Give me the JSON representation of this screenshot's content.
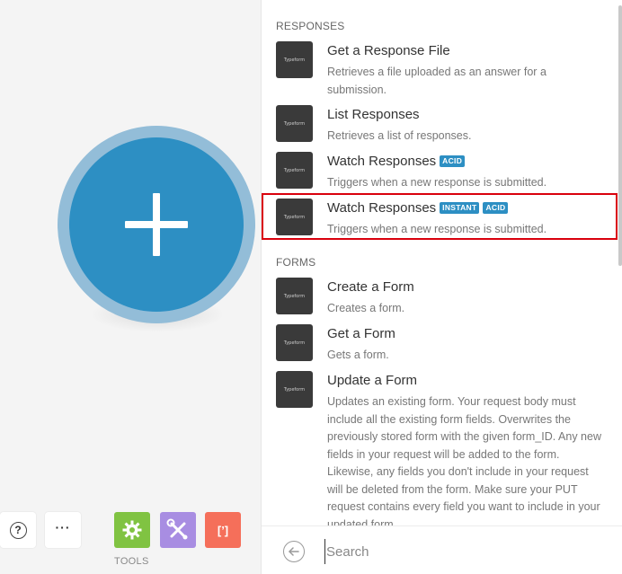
{
  "toolbar": {
    "help_icon_text": "?",
    "more_icon_text": "···",
    "tools_label": "TOOLS",
    "json_tool_text": "[’]"
  },
  "panel": {
    "sections": [
      {
        "title": "RESPONSES",
        "items": [
          {
            "logo": "Typeform",
            "title": "Get a Response File",
            "badges": [],
            "desc": "Retrieves a file uploaded as an answer for a submission."
          },
          {
            "logo": "Typeform",
            "title": "List Responses",
            "badges": [],
            "desc": "Retrieves a list of responses."
          },
          {
            "logo": "Typeform",
            "title": "Watch Responses",
            "badges": [
              "ACID"
            ],
            "desc": "Triggers when a new response is submitted."
          },
          {
            "logo": "Typeform",
            "title": "Watch Responses",
            "badges": [
              "INSTANT",
              "ACID"
            ],
            "desc": "Triggers when a new response is submitted."
          }
        ]
      },
      {
        "title": "FORMS",
        "items": [
          {
            "logo": "Typeform",
            "title": "Create a Form",
            "badges": [],
            "desc": "Creates a form."
          },
          {
            "logo": "Typeform",
            "title": "Get a Form",
            "badges": [],
            "desc": "Gets a form."
          },
          {
            "logo": "Typeform",
            "title": "Update a Form",
            "badges": [],
            "desc": "Updates an existing form. Your request body must include all the existing form fields. Overwrites the previously stored form with the given form_ID. Any new fields in your request will be added to the form. Likewise, any fields you don't include in your request will be deleted from the form. Make sure your PUT request contains every field you want to include in your updated form."
          }
        ]
      }
    ],
    "search": {
      "placeholder": "Search",
      "value": ""
    }
  },
  "colors": {
    "accent": "#2d8fc3",
    "highlight": "#d9000d",
    "tool_gear": "#80c342",
    "tool_wrench": "#a88de2",
    "tool_json": "#f56f5a"
  }
}
